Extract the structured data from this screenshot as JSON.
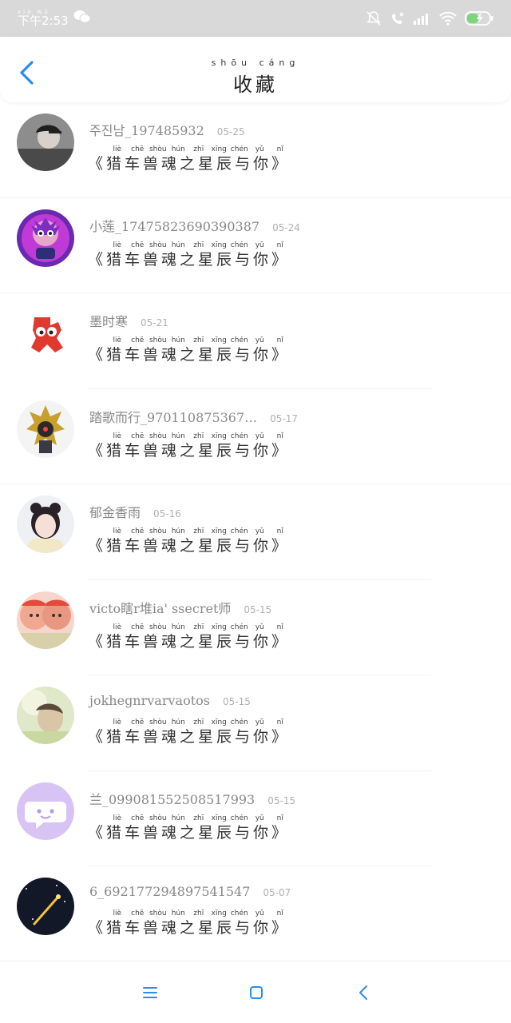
{
  "status_bar": {
    "time_pinyin": "xià wǔ",
    "time": "下午2:53"
  },
  "header": {
    "title_pinyin": "shōu cáng",
    "title": "收藏"
  },
  "post_pinyin": [
    "liè",
    "chē",
    "shòu",
    "hún",
    "zhī",
    "xīng",
    "chén",
    "yǔ",
    "nǐ"
  ],
  "items": [
    {
      "username": "주진남_197485932",
      "date": "05-25",
      "title": "《猎车兽魂之星辰与你》"
    },
    {
      "username": "小莲_17475823690390387",
      "date": "05-24",
      "title": "《猎车兽魂之星辰与你》"
    },
    {
      "username": "墨时寒",
      "date": "05-21",
      "title": "《猎车兽魂之星辰与你》"
    },
    {
      "username": "踏歌而行_970110875367…",
      "date": "05-17",
      "title": "《猎车兽魂之星辰与你》"
    },
    {
      "username": "郁金香雨",
      "date": "05-16",
      "title": "《猎车兽魂之星辰与你》"
    },
    {
      "username": "victo瞎r堆ia' ssecret师",
      "date": "05-15",
      "title": "《猎车兽魂之星辰与你》"
    },
    {
      "username": "jokhegnrvarvaotos",
      "date": "05-15",
      "title": "《猎车兽魂之星辰与你》"
    },
    {
      "username": "兰_099081552508517993",
      "date": "05-15",
      "title": "《猎车兽魂之星辰与你》"
    },
    {
      "username": "6_692177294897541547",
      "date": "05-07",
      "title": "《猎车兽魂之星辰与你》"
    }
  ],
  "colors": {
    "accent": "#2a8cf0",
    "status_bar_bg": "#d9d9d9"
  }
}
